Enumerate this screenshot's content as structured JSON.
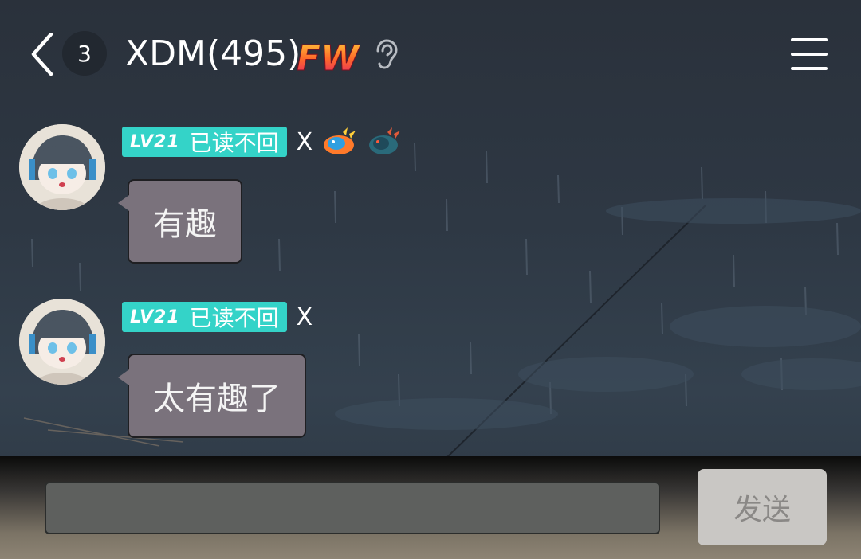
{
  "header": {
    "unread_count": "3",
    "chat_title": "XDM(495)",
    "fw_badge_text": "FW"
  },
  "messages": [
    {
      "level": "LV21",
      "title": "已读不回",
      "sender": "X",
      "text": "有趣",
      "medals": [
        "dragon-medal-fire-icon",
        "dragon-medal-dark-icon"
      ]
    },
    {
      "level": "LV21",
      "title": "已读不回",
      "sender": "X",
      "text": "太有趣了",
      "medals": []
    }
  ],
  "composer": {
    "input_value": "",
    "send_label": "发送"
  },
  "colors": {
    "level_tag": "#34d3c8",
    "bubble": "#7a727c",
    "send_button": "#c9c7c4"
  }
}
